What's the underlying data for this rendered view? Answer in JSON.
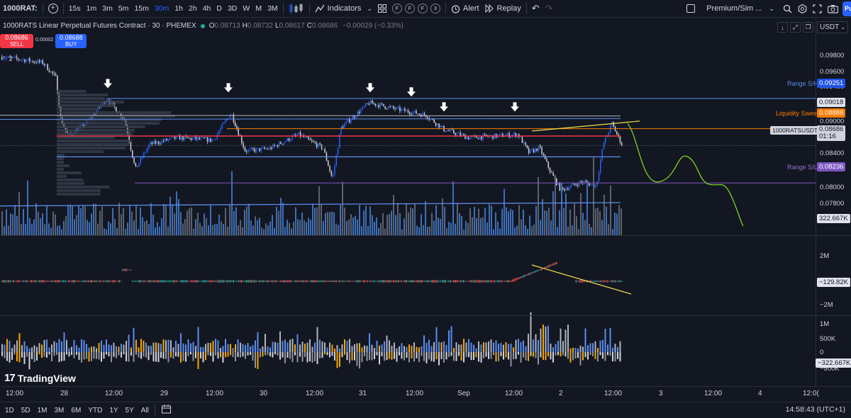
{
  "toolbar": {
    "symbol": "1000RAT:",
    "timeframes": [
      "15s",
      "1m",
      "3m",
      "5m",
      "15m",
      "30m",
      "1h",
      "2h",
      "4h",
      "D",
      "3D",
      "W",
      "M",
      "3M"
    ],
    "active_timeframe": "30m",
    "indicators_label": "Indicators",
    "round_tags": [
      "F",
      "F",
      "F",
      "3"
    ],
    "alert_label": "Alert",
    "replay_label": "Replay",
    "account_label": "Premium/Sim ...",
    "publish_label": "Pu"
  },
  "legend": {
    "title": "1000RATS Linear Perpetual Futures Contract · 30 · PHEMEX",
    "ohlc": [
      {
        "k": "O",
        "v": "0.08713"
      },
      {
        "k": "H",
        "v": "0.08732"
      },
      {
        "k": "L",
        "v": "0.08617"
      },
      {
        "k": "C",
        "v": "0.08686"
      }
    ],
    "change": "−0.00029 (−0.33%)"
  },
  "trade": {
    "sell_price": "0.08686",
    "sell_label": "SELL",
    "spread": "0.00002",
    "buy_price": "0.08688",
    "buy_label": "BUY",
    "collapse_count": "1"
  },
  "currency": "USDT",
  "price_axis": [
    "0.09800",
    "0.09600",
    "0.09400",
    "0.09000",
    "0.08800",
    "0.08600",
    "0.08400",
    "0.08200",
    "0.08000",
    "0.07800"
  ],
  "price_tags": {
    "range_sh_label": "Range S/H",
    "range_sh": "0.09251",
    "level_1": "0.09018",
    "liquidity_label": "Liquidity Sweep",
    "liquidity": "0.08888",
    "symbol_tag": "1000RATSUSDT.P",
    "last_price": "0.08686",
    "countdown": "01:16",
    "range_sl_label": "Range S/L",
    "range_sl": "0.08236",
    "volume": "322.667K"
  },
  "pane2": {
    "top_label": "2M",
    "value": "−129.82K",
    "bottom_label": "−2M"
  },
  "pane3": {
    "l1": "1M",
    "l2": "500K",
    "l3": "0",
    "value": "−322.667K",
    "l4": "−500K"
  },
  "time_axis": [
    {
      "t": "12:00"
    },
    {
      "t": "28"
    },
    {
      "t": "12:00"
    },
    {
      "t": "29"
    },
    {
      "t": "12:00"
    },
    {
      "t": "30"
    },
    {
      "t": "12:00"
    },
    {
      "t": "31"
    },
    {
      "t": "12:00"
    },
    {
      "t": "Sep"
    },
    {
      "t": "12:00"
    },
    {
      "t": "2"
    },
    {
      "t": "12:00"
    },
    {
      "t": "3"
    },
    {
      "t": "12:00"
    },
    {
      "t": "4"
    },
    {
      "t": "12:0("
    }
  ],
  "ranges": [
    "1D",
    "5D",
    "1M",
    "3M",
    "6M",
    "YTD",
    "1Y",
    "5Y",
    "All"
  ],
  "clock": "14:58:43 (UTC+1)",
  "brand": "TradingView",
  "colors": {
    "background": "#131722",
    "up_candle": "#2962ff",
    "down_candle": "#d1d4dc",
    "range_line": "#5b8def",
    "liquidity_line": "#f57c00",
    "range_sl": "#7e57c2",
    "trend_line": "#f5e04c",
    "projection": "#7ed321",
    "sell": "#f23645",
    "buy": "#2962ff"
  }
}
